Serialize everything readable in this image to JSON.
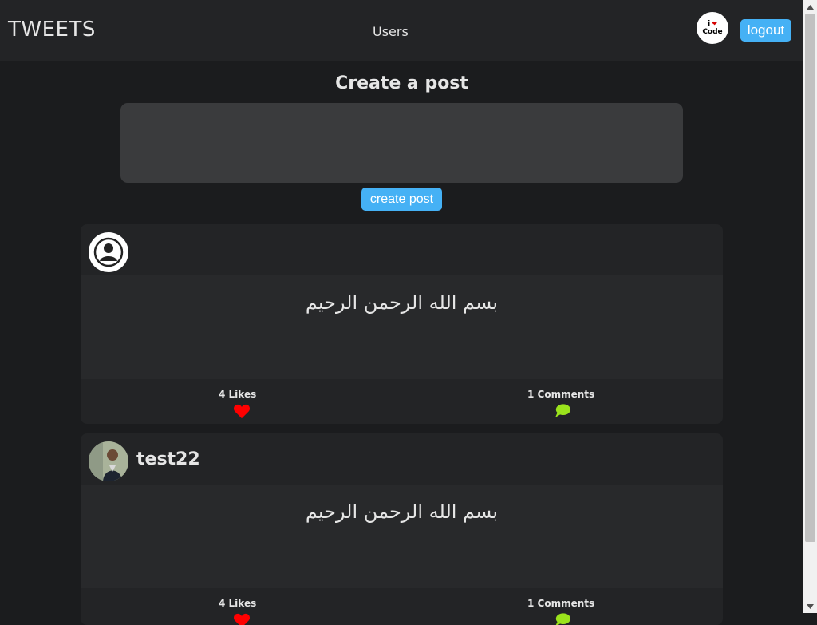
{
  "header": {
    "brand": "TWEETS",
    "nav_users": "Users",
    "logo_top": "i",
    "logo_bottom": "Code",
    "logout_label": "logout"
  },
  "create": {
    "title": "Create a post",
    "textarea_value": "",
    "button_label": "create post"
  },
  "posts": [
    {
      "username": "",
      "avatar": "default-user-icon",
      "text": "بسم الله الرحمن الرحيم",
      "likes_label": "4 Likes",
      "comments_label": "1 Comments"
    },
    {
      "username": "test22",
      "avatar": "user-photo",
      "text": "بسم الله الرحمن الرحيم",
      "likes_label": "4 Likes",
      "comments_label": "1 Comments"
    }
  ],
  "colors": {
    "accent": "#45b1f5",
    "like": "#ff0000",
    "comment": "#9be31c",
    "background": "#1b1c1e",
    "card": "#232426"
  }
}
